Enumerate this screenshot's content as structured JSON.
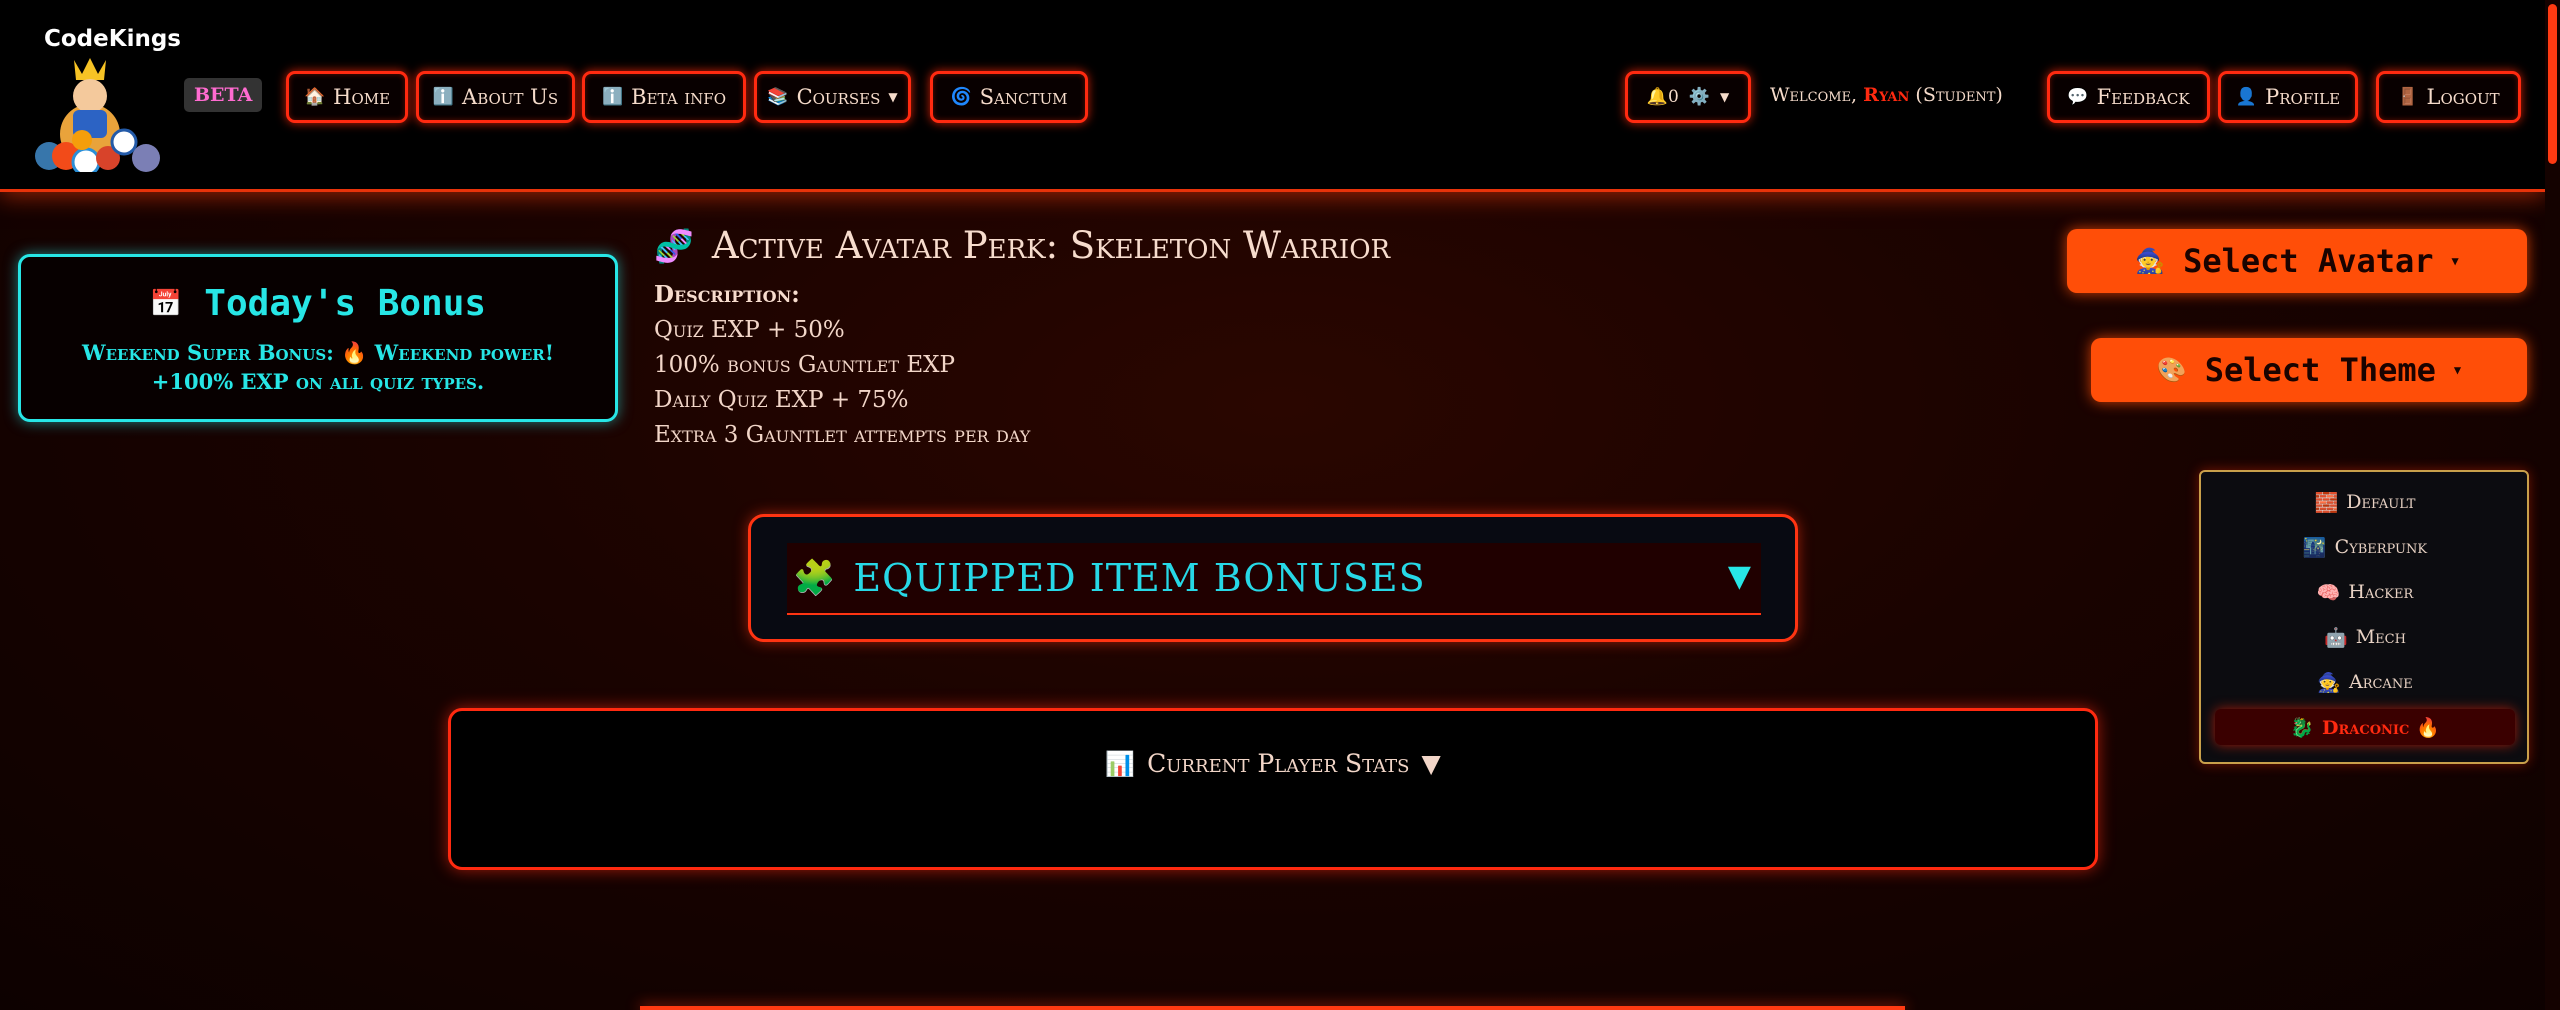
{
  "brand": {
    "name": "CodeKings",
    "badge": "BETA"
  },
  "nav": {
    "home": "Home",
    "about": "About Us",
    "beta_info": "Beta info",
    "courses": "Courses",
    "sanctum": "Sanctum",
    "notifications_count": "0",
    "feedback": "Feedback",
    "profile": "Profile",
    "logout": "Logout"
  },
  "welcome": {
    "prefix": "Welcome,",
    "user": "Ryan",
    "role": "(Student)"
  },
  "bonus": {
    "title": "Today's Bonus",
    "text": "Weekend Super Bonus: 🔥 Weekend power! +100% EXP on all quiz types."
  },
  "perk": {
    "title": "Active Avatar Perk: Skeleton Warrior",
    "description_label": "Description:",
    "lines": [
      "Quiz EXP + 50%",
      "100% bonus Gauntlet EXP",
      "Daily Quiz EXP + 75%",
      "Extra 3 Gauntlet attempts per day"
    ]
  },
  "select_avatar": "Select Avatar",
  "select_theme": "Select Theme",
  "themes": [
    {
      "icon": "🧱",
      "label": "Default"
    },
    {
      "icon": "🌃",
      "label": "Cyberpunk"
    },
    {
      "icon": "🧠",
      "label": "Hacker"
    },
    {
      "icon": "🤖",
      "label": "Mech"
    },
    {
      "icon": "🧙",
      "label": "Arcane"
    },
    {
      "icon": "🐉",
      "label": "Draconic 🔥",
      "active": true
    }
  ],
  "equipped": {
    "title": "EQUIPPED ITEM BONUSES",
    "toggle": "▼"
  },
  "stats": {
    "title": "Current Player Stats",
    "toggle": "▼"
  },
  "colors": {
    "accent": "#ff2a10",
    "cyan": "#27e6e6",
    "orange": "#ff4e08",
    "background": "#1a0300"
  }
}
